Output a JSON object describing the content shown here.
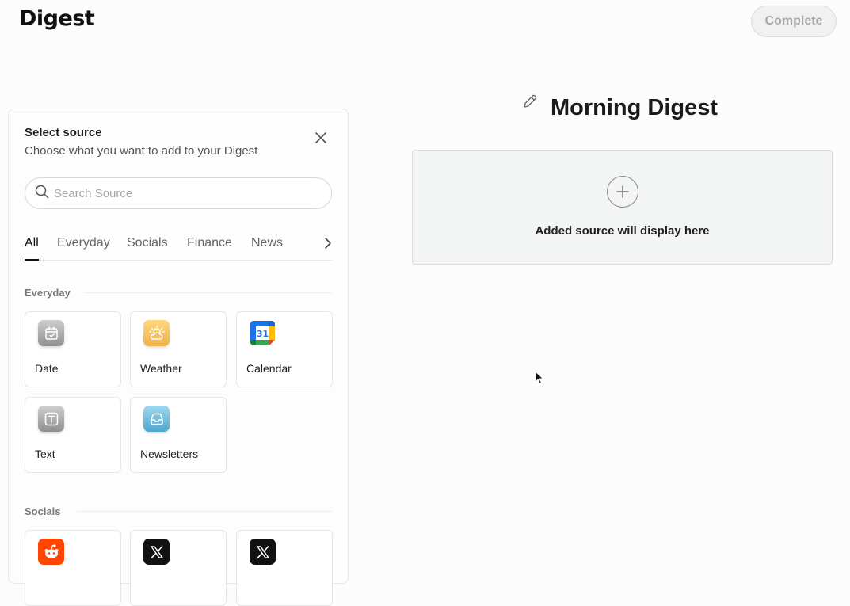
{
  "header": {
    "logo_text": "Digest",
    "complete_label": "Complete"
  },
  "panel": {
    "title": "Select source",
    "subtitle": "Choose what you want to add to your Digest",
    "search_placeholder": "Search Source",
    "tabs": [
      "All",
      "Everyday",
      "Socials",
      "Finance",
      "News"
    ],
    "active_tab": "All",
    "sections": [
      {
        "label": "Everyday",
        "items": [
          {
            "label": "Date",
            "icon": "calendar-check-icon"
          },
          {
            "label": "Weather",
            "icon": "weather-sun-cloud-icon"
          },
          {
            "label": "Calendar",
            "icon": "google-calendar-icon"
          },
          {
            "label": "Text",
            "icon": "text-t-icon"
          },
          {
            "label": "Newsletters",
            "icon": "inbox-tray-icon"
          }
        ]
      },
      {
        "label": "Socials",
        "items": [
          {
            "label": "",
            "icon": "reddit-icon"
          },
          {
            "label": "",
            "icon": "x-logo-icon"
          },
          {
            "label": "",
            "icon": "x-logo-icon"
          }
        ]
      }
    ]
  },
  "digest": {
    "title": "Morning Digest",
    "placeholder_text": "Added source will display here"
  },
  "colors": {
    "reddit": "#ff4500",
    "x": "#111111",
    "weather": "#f0b04a",
    "newsletters": "#4ba8d0"
  }
}
